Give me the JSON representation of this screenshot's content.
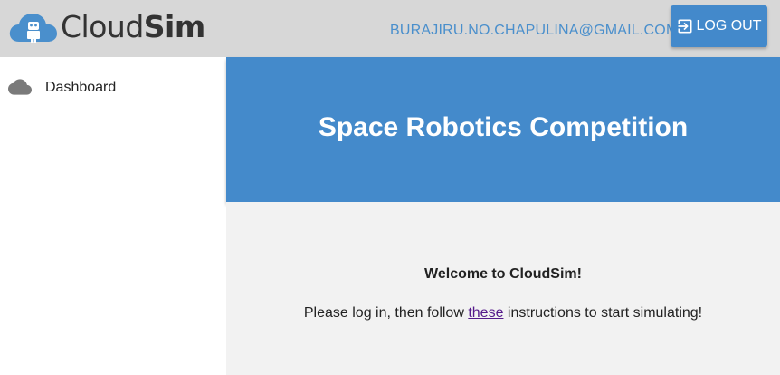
{
  "header": {
    "brand": {
      "name_light": "Cloud",
      "name_bold": "Sim",
      "logo_icon": "cloud-robot-logo"
    },
    "user_email": "BURAJIRU.NO.CHAPULINA@GMAIL.COM",
    "logout_label": "LOG OUT",
    "logout_icon": "exit-to-app-icon"
  },
  "sidebar": {
    "items": [
      {
        "label": "Dashboard",
        "icon": "cloud-icon"
      }
    ]
  },
  "banner": {
    "title": "Space Robotics Competition"
  },
  "main": {
    "welcome": "Welcome to CloudSim!",
    "instructions_before": "Please log in, then follow ",
    "instructions_link": "these",
    "instructions_after": " instructions to start simulating!"
  },
  "colors": {
    "topbar_bg": "#d7d7d7",
    "accent_blue": "#448acb",
    "content_bg": "#f2f2f2",
    "link_visited": "#551a8b"
  }
}
